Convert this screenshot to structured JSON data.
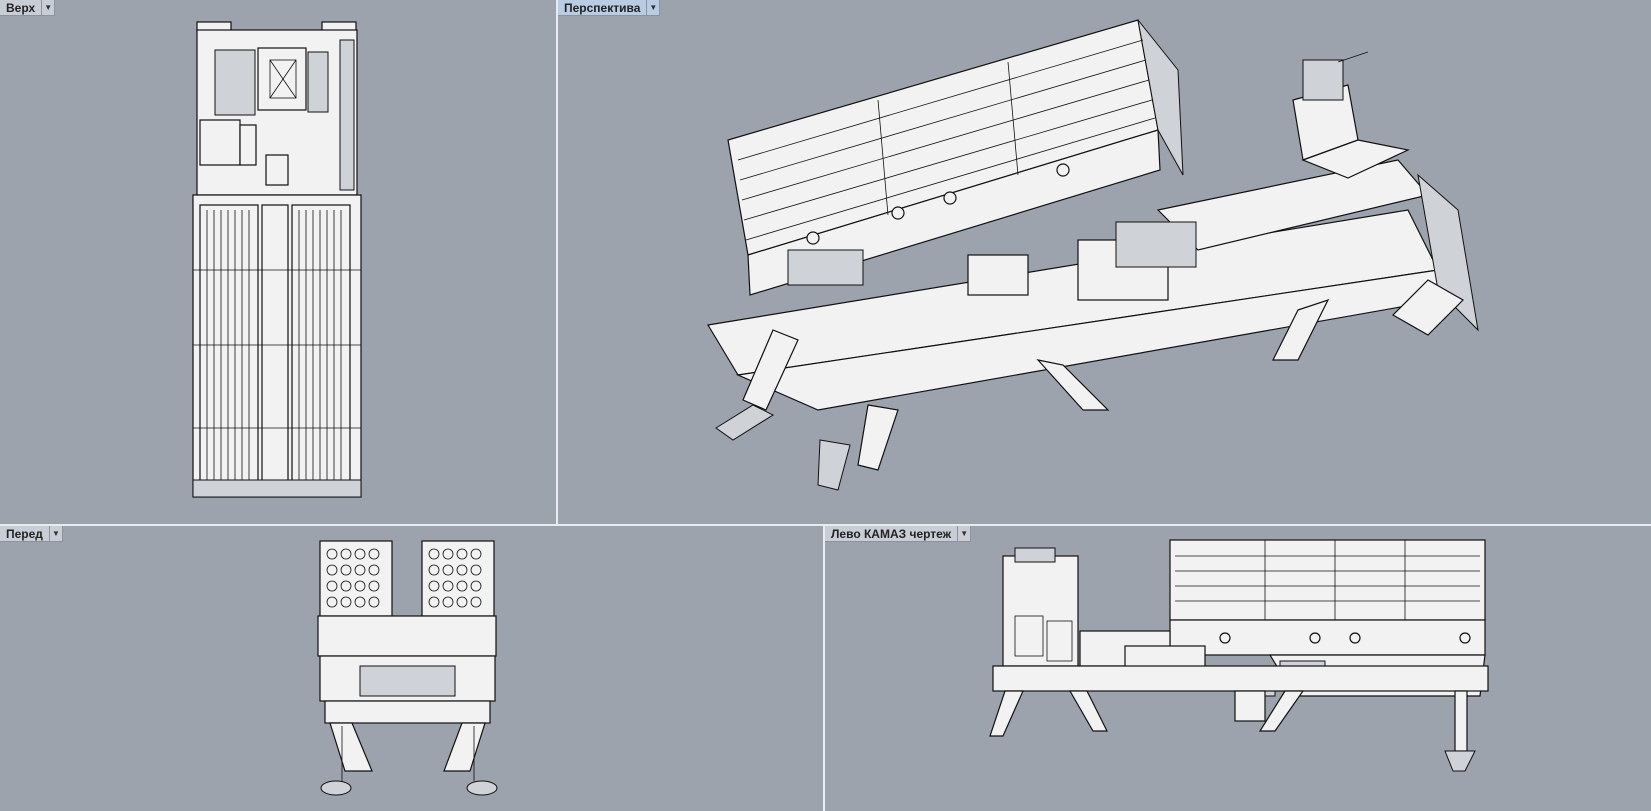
{
  "viewports": {
    "top": {
      "label": "Верх"
    },
    "perspective": {
      "label": "Перспектива"
    },
    "front": {
      "label": "Перед"
    },
    "left": {
      "label": "Лево КАМАЗ чертеж"
    }
  },
  "icons": {
    "dropdown": "chevron-down-icon"
  },
  "colors": {
    "background": "#9ca3ad",
    "divider": "#e8ebef",
    "active_tab": "#b8cde4",
    "tab": "#c9ced6"
  }
}
